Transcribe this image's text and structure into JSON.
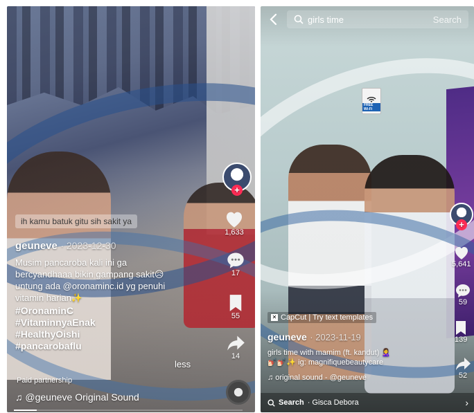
{
  "left_video": {
    "caption_bubble": "ih kamu batuk gitu sih sakit ya",
    "username": "geuneve",
    "date": "· 2023-12-30",
    "description": "Musim pancaroba kali ini ga bercyandhaaa bikin gampang sakit😥 untung ada @oronaminc.id yg penuhi vitamin harian✨",
    "hashtags": [
      "#OronaminC",
      "#VitaminnyaEnak",
      "#HealthyOishi",
      "#pancarobaflu"
    ],
    "less_label": "less",
    "paid_label": "Paid partnership",
    "sound": "♫ @geuneve Original Sound",
    "likes": "1,633",
    "comments": "17",
    "saves": "55",
    "shares": "14"
  },
  "right_video": {
    "search_query": "girls time",
    "search_button": "Search",
    "wifi_sign": "FREE Wi-Fi",
    "capcut_label": "CapCut | Try text templates",
    "username": "geuneve",
    "date": "· 2023-11-19",
    "description_line1": "girls time with mamim (ft. kandut) 🙎‍♀️",
    "description_line2": "💅🏻💅🏻✨ ig: magnifiquebeautycare",
    "sound": "♫ original sound - @geuneve",
    "bottom_search_label": "Search",
    "bottom_search_term": "· Gisca Debora",
    "likes": "5,641",
    "comments": "59",
    "saves": "139",
    "shares": "52"
  },
  "colors": {
    "like_red": "#fe2c55",
    "text_white": "#ffffff"
  },
  "icons": [
    "heart-icon",
    "comment-icon",
    "bookmark-icon",
    "share-icon",
    "search-icon",
    "back-icon",
    "music-note-icon",
    "plus-icon"
  ]
}
